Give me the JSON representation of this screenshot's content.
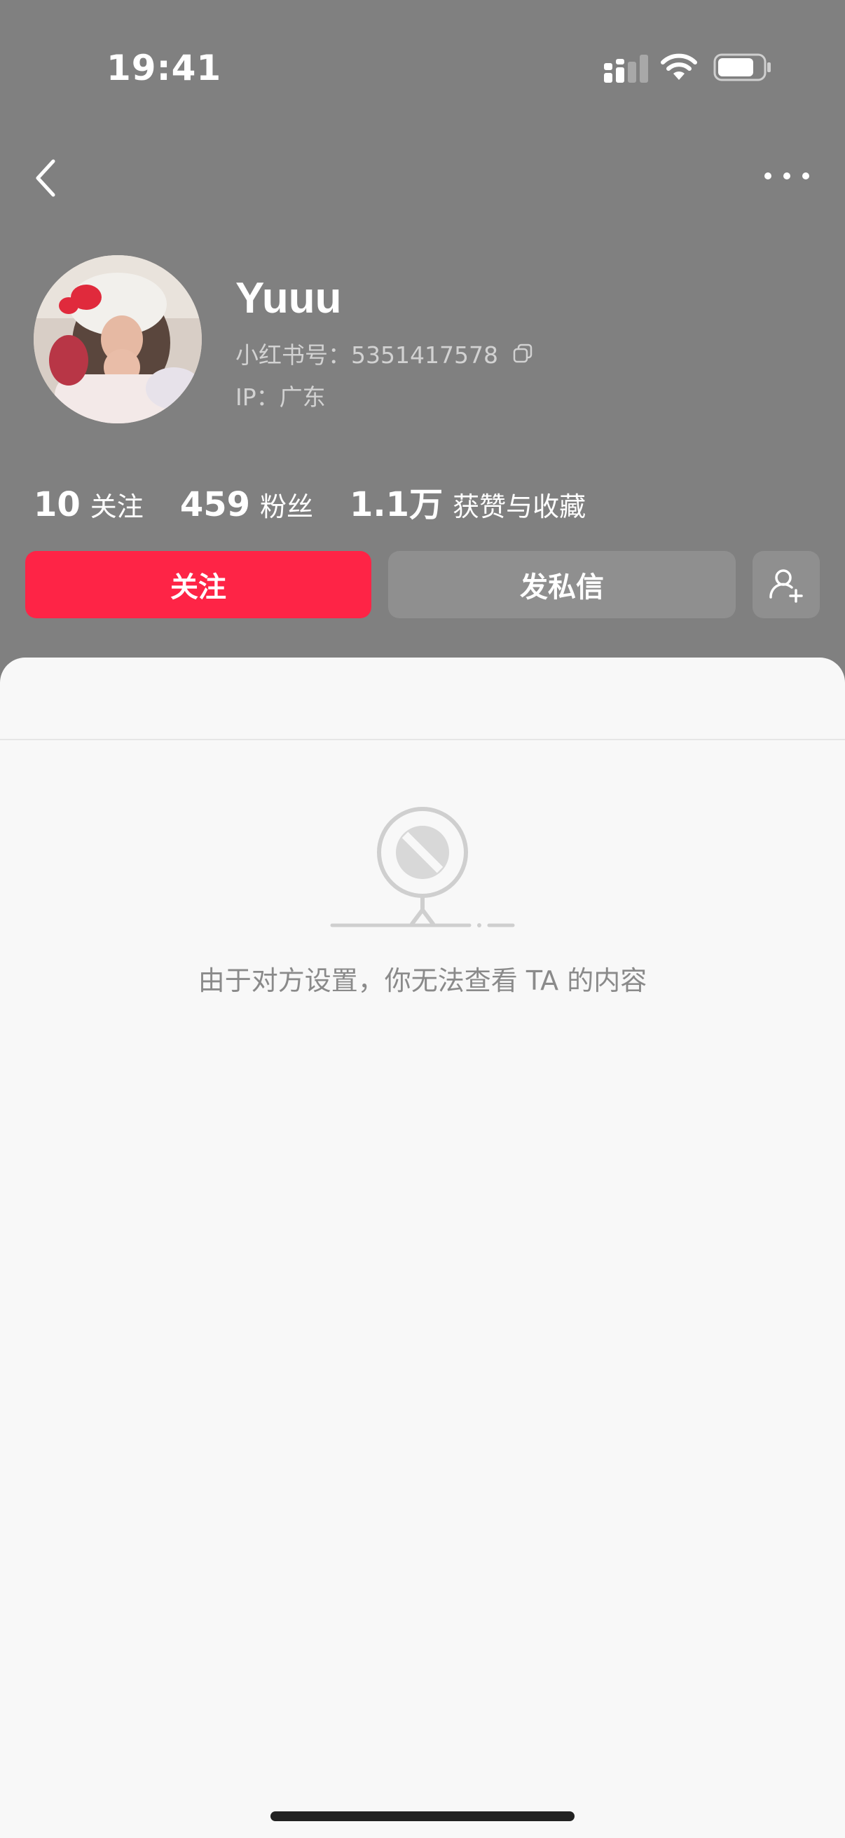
{
  "status_bar": {
    "time": "19:41"
  },
  "profile": {
    "name": "Yuuu",
    "red_id": "小红书号：5351417578",
    "ip": "IP：广东"
  },
  "stats": [
    {
      "value": "10",
      "label": "关注"
    },
    {
      "value": "459",
      "label": "粉丝"
    },
    {
      "value": "1.1万",
      "label": "获赞与收藏"
    }
  ],
  "actions": {
    "follow_label": "关注",
    "message_label": "发私信"
  },
  "empty_state": {
    "message": "由于对方设置，你无法查看 TA 的内容"
  },
  "colors": {
    "header_bg": "#808080",
    "accent": "#fe2446",
    "secondary_button": "#8f8f8f",
    "sheet_bg": "#f8f8f8"
  },
  "icons": [
    "back-icon",
    "more-icon",
    "copy-icon",
    "add-user-icon",
    "blocked-icon"
  ]
}
